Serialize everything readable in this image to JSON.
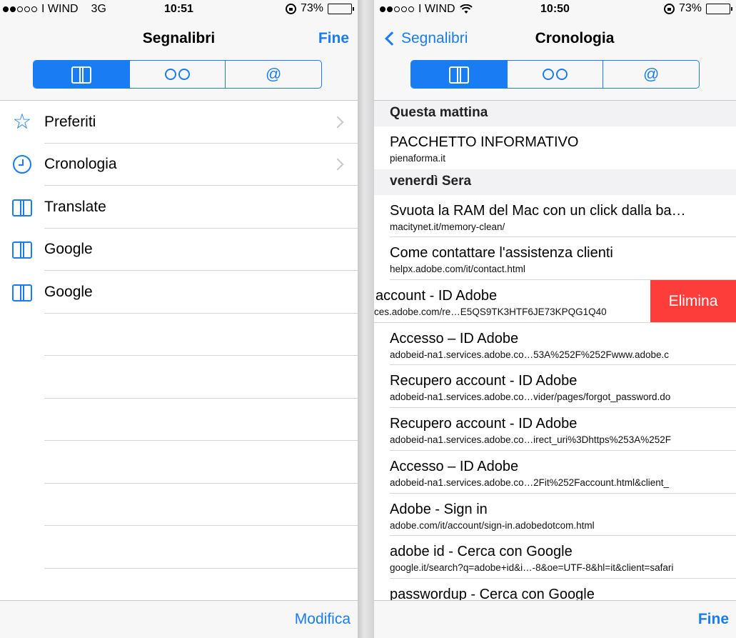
{
  "left": {
    "status": {
      "carrier": "I WIND",
      "network": "3G",
      "time": "10:51",
      "battery": "73%",
      "battery_level": 0.73
    },
    "title": "Segnalibri",
    "done_label": "Fine",
    "tabs": [
      {
        "icon": "bookmarks-book-icon",
        "selected": true
      },
      {
        "icon": "reading-list-glasses-icon",
        "selected": false
      },
      {
        "label": "@",
        "icon": "shared-links-at-icon",
        "selected": false
      }
    ],
    "items": [
      {
        "label": "Preferiti",
        "icon": "star-icon",
        "disclosure": true
      },
      {
        "label": "Cronologia",
        "icon": "clock-icon",
        "disclosure": true
      },
      {
        "label": "Translate",
        "icon": "book-icon",
        "disclosure": false
      },
      {
        "label": "Google",
        "icon": "book-icon",
        "disclosure": false
      },
      {
        "label": "Google",
        "icon": "book-icon",
        "disclosure": false
      }
    ],
    "toolbar_action": "Modifica"
  },
  "right": {
    "status": {
      "carrier": "I WIND",
      "time": "10:50",
      "battery": "73%",
      "battery_level": 0.73
    },
    "back_label": "Segnalibri",
    "title": "Cronologia",
    "tabs": [
      {
        "icon": "bookmarks-book-icon",
        "selected": true
      },
      {
        "icon": "reading-list-glasses-icon",
        "selected": false
      },
      {
        "label": "@",
        "icon": "shared-links-at-icon",
        "selected": false
      }
    ],
    "sections": [
      {
        "header": "Questa mattina",
        "rows": [
          {
            "title": "PACCHETTO INFORMATIVO",
            "url": "pienaforma.it"
          }
        ]
      },
      {
        "header": "venerdì Sera",
        "rows": [
          {
            "title": "Svuota la RAM del Mac con un click dalla ba…",
            "url": "macitynet.it/memory-clean/"
          },
          {
            "title": "Come contattare l'assistenza clienti",
            "url": "helpx.adobe.com/it/contact.html"
          },
          {
            "title": "account - ID Adobe",
            "url": "ces.adobe.com/re…E5QS9TK3HTF6JE73KPQG1Q40",
            "swiped": true,
            "delete_label": "Elimina"
          },
          {
            "title": "Accesso – ID Adobe",
            "url": "adobeid-na1.services.adobe.co…53A%252F%252Fwww.adobe.c"
          },
          {
            "title": "Recupero account - ID Adobe",
            "url": "adobeid-na1.services.adobe.co…vider/pages/forgot_password.do"
          },
          {
            "title": "Recupero account - ID Adobe",
            "url": "adobeid-na1.services.adobe.co…irect_uri%3Dhttps%253A%252F"
          },
          {
            "title": "Accesso – ID Adobe",
            "url": "adobeid-na1.services.adobe.co…2Fit%252Faccount.html&client_"
          },
          {
            "title": "Adobe - Sign in",
            "url": "adobe.com/it/account/sign-in.adobedotcom.html"
          },
          {
            "title": "adobe id - Cerca con Google",
            "url": "google.it/search?q=adobe+id&i…-8&oe=UTF-8&hl=it&client=safari"
          },
          {
            "title": "passwordup - Cerca con Google",
            "url": ""
          }
        ]
      }
    ],
    "toolbar_action": "Fine"
  }
}
